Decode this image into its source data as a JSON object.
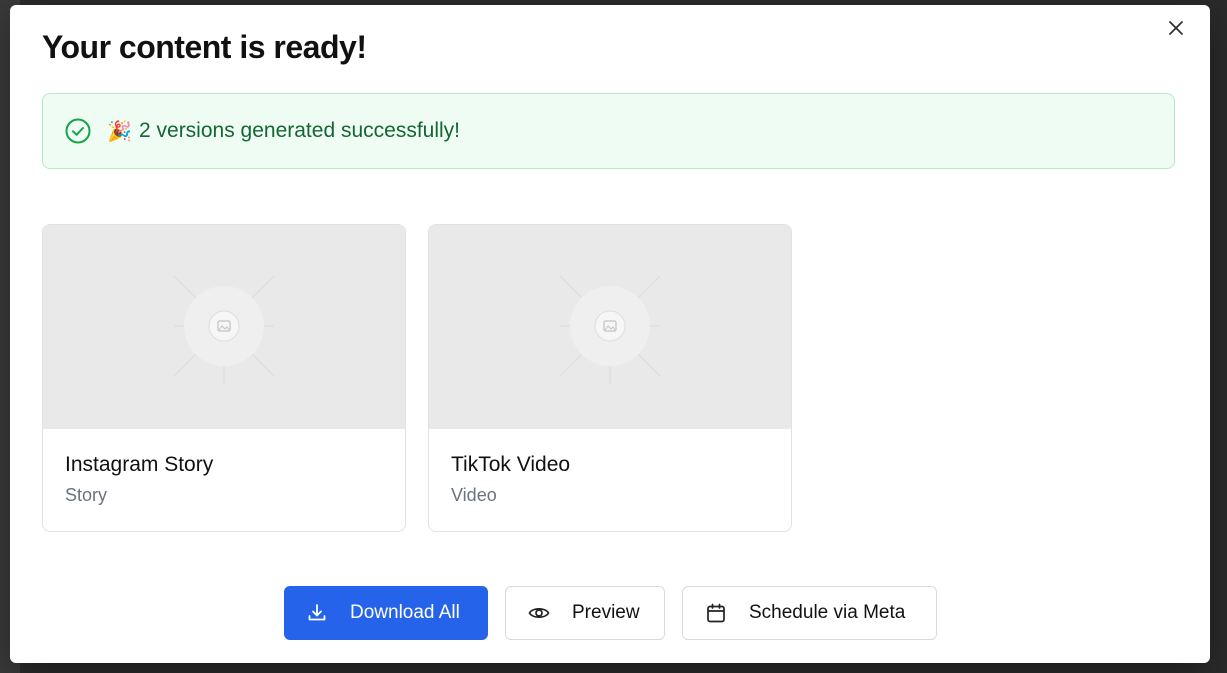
{
  "modal": {
    "title": "Your content is ready!",
    "close_icon": "close-icon",
    "alert": {
      "icon": "check-circle-icon",
      "emoji": "🎉",
      "message": "2 versions generated successfully!",
      "color": "#166534"
    }
  },
  "cards": [
    {
      "title": "Instagram Story",
      "subtitle": "Story",
      "thumbnail_icon": "image-placeholder-icon"
    },
    {
      "title": "TikTok Video",
      "subtitle": "Video",
      "thumbnail_icon": "image-placeholder-icon"
    }
  ],
  "actions": {
    "download": {
      "label": "Download All",
      "icon": "download-icon",
      "color": "#2563eb"
    },
    "preview": {
      "label": "Preview",
      "icon": "eye-icon"
    },
    "schedule": {
      "label": "Schedule via Meta",
      "icon": "calendar-icon"
    }
  }
}
